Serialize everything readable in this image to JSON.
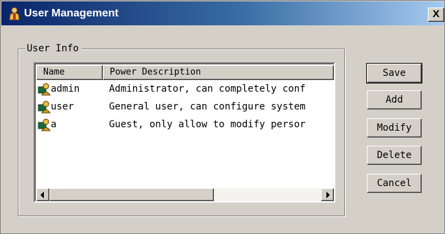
{
  "window": {
    "title": "User Management",
    "close_label": "X"
  },
  "group": {
    "legend": "User Info"
  },
  "list": {
    "columns": [
      "Name",
      "Power Description"
    ],
    "rows": [
      {
        "name": "admin",
        "description": "Administrator, can completely conf"
      },
      {
        "name": "user",
        "description": "General user, can configure system"
      },
      {
        "name": "a",
        "description": "Guest, only allow to modify persor"
      }
    ]
  },
  "buttons": {
    "save": "Save",
    "add": "Add",
    "modify": "Modify",
    "delete": "Delete",
    "cancel": "Cancel"
  },
  "icons": {
    "app": "user-management-icon",
    "user": "user-icon"
  }
}
